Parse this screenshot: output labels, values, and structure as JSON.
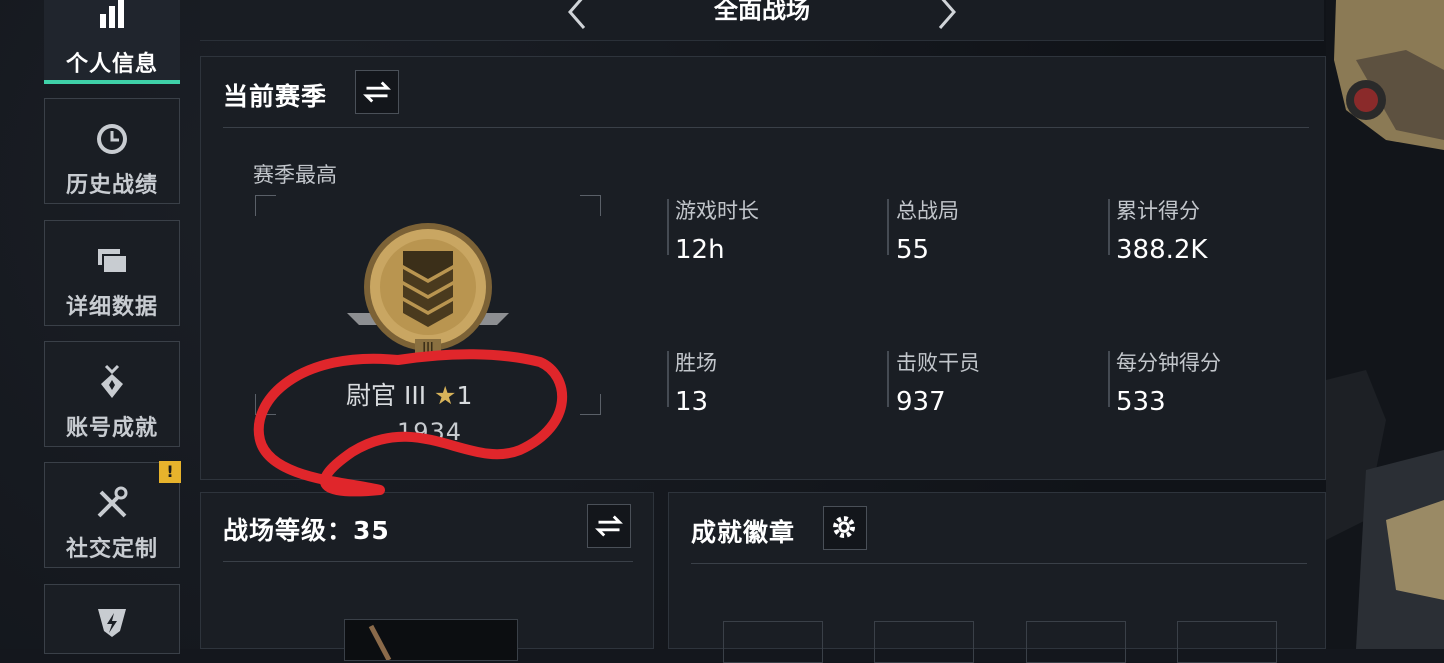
{
  "sidebar": {
    "items": [
      {
        "label": "个人信息",
        "icon": "bar-chart-icon",
        "active": true
      },
      {
        "label": "历史战绩",
        "icon": "clock-icon"
      },
      {
        "label": "详细数据",
        "icon": "folders-icon"
      },
      {
        "label": "账号成就",
        "icon": "medal-icon"
      },
      {
        "label": "社交定制",
        "icon": "tools-icon",
        "badge": "!"
      },
      {
        "label": "",
        "icon": "lightning-icon"
      }
    ]
  },
  "header": {
    "mode_title": "全面战场"
  },
  "season": {
    "title": "当前赛季",
    "best_label": "赛季最高",
    "rank_name": "尉官 III",
    "rank_stars": "1",
    "rank_score": "1934",
    "stats": [
      {
        "label": "游戏时长",
        "value": "12h"
      },
      {
        "label": "总战局",
        "value": "55"
      },
      {
        "label": "累计得分",
        "value": "388.2K"
      },
      {
        "label": "胜场",
        "value": "13"
      },
      {
        "label": "击败干员",
        "value": "937"
      },
      {
        "label": "每分钟得分",
        "value": "533"
      }
    ]
  },
  "battlefield": {
    "title": "战场等级：35"
  },
  "achievements": {
    "title": "成就徽章"
  },
  "colors": {
    "accent": "#3fd1a8",
    "badge": "#e7b32c",
    "annotation": "#e0262b",
    "medal_gold": "#c9a662"
  }
}
